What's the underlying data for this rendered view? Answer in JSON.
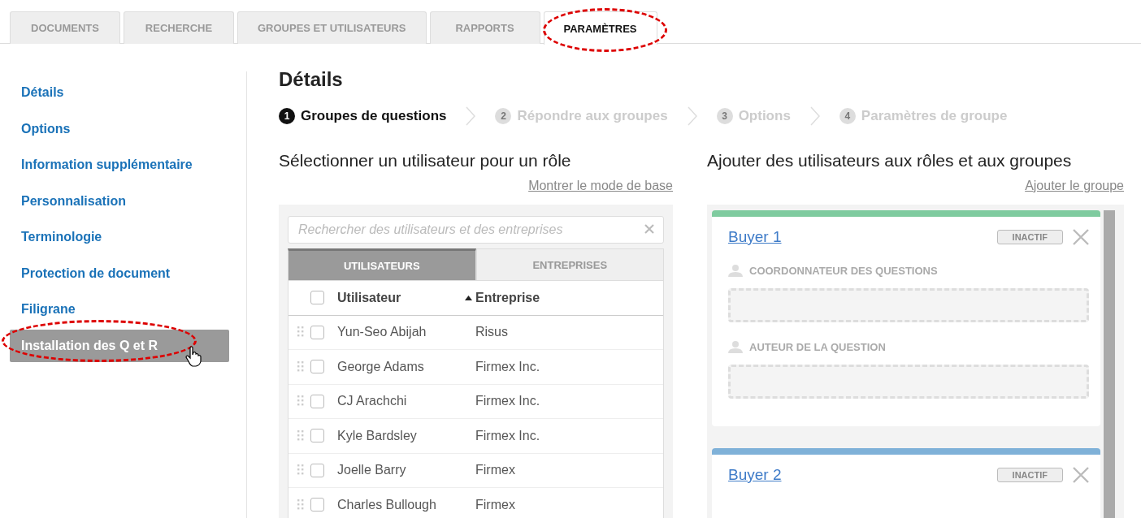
{
  "tabs": [
    {
      "label": "DOCUMENTS",
      "selected": false
    },
    {
      "label": "RECHERCHE",
      "selected": false
    },
    {
      "label": "GROUPES ET UTILISATEURS",
      "selected": false
    },
    {
      "label": "RAPPORTS",
      "selected": false
    },
    {
      "label": "PARAMÈTRES",
      "selected": true
    }
  ],
  "sidebar": {
    "items": [
      {
        "label": "Détails",
        "selected": false
      },
      {
        "label": "Options",
        "selected": false
      },
      {
        "label": "Information supplémentaire",
        "selected": false
      },
      {
        "label": "Personnalisation",
        "selected": false
      },
      {
        "label": "Terminologie",
        "selected": false
      },
      {
        "label": "Protection de document",
        "selected": false
      },
      {
        "label": "Filigrane",
        "selected": false
      },
      {
        "label": "Installation des Q et R",
        "selected": true
      }
    ]
  },
  "page_title": "Détails",
  "steps": [
    {
      "number": "1",
      "label": "Groupes de questions",
      "selected": true
    },
    {
      "number": "2",
      "label": "Répondre aux groupes",
      "selected": false
    },
    {
      "number": "3",
      "label": "Options",
      "selected": false
    },
    {
      "number": "4",
      "label": "Paramètres de groupe",
      "selected": false
    }
  ],
  "users_panel": {
    "heading": "Sélectionner un utilisateur pour un rôle",
    "link": "Montrer le mode de base",
    "search": {
      "placeholder": "Rechercher des utilisateurs et des entreprises"
    },
    "subtabs": [
      {
        "label": "UTILISATEURS",
        "selected": true
      },
      {
        "label": "ENTREPRISES",
        "selected": false
      }
    ],
    "select_all_checked": false,
    "columns": [
      {
        "label": "Utilisateur",
        "sorted": false
      },
      {
        "label": "Entreprise",
        "sorted": true
      }
    ],
    "rows": [
      {
        "user": "Yun-Seo Abijah",
        "company": "Risus",
        "checked": false
      },
      {
        "user": "George Adams",
        "company": "Firmex Inc.",
        "checked": false
      },
      {
        "user": "CJ Arachchi",
        "company": "Firmex Inc.",
        "checked": false
      },
      {
        "user": "Kyle Bardsley",
        "company": "Firmex Inc.",
        "checked": false
      },
      {
        "user": "Joelle Barry",
        "company": "Firmex",
        "checked": false
      },
      {
        "user": "Charles Bullough",
        "company": "Firmex",
        "checked": false
      }
    ]
  },
  "groups_panel": {
    "heading": "Ajouter des utilisateurs aux rôles et aux groupes",
    "link": "Ajouter le groupe",
    "groups": [
      {
        "name": "Buyer 1",
        "status": "INACTIF",
        "color": "#7fcb9f",
        "roles": [
          "COORDONNATEUR DES QUESTIONS",
          "AUTEUR DE LA QUESTION"
        ]
      },
      {
        "name": "Buyer 2",
        "status": "INACTIF",
        "color": "#7fb1d8"
      }
    ]
  }
}
